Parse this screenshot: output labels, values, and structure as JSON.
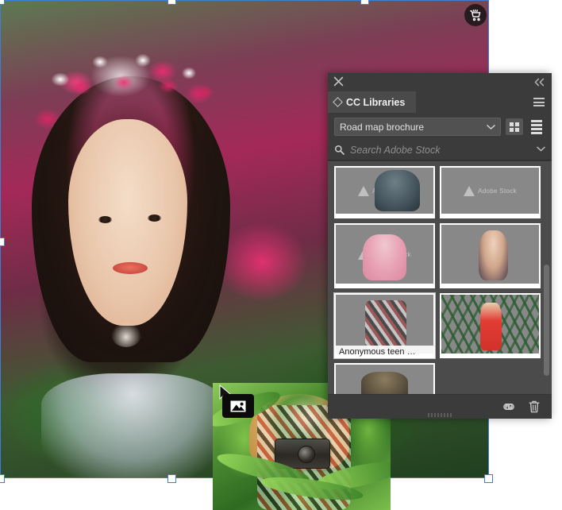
{
  "canvas": {
    "name": "artboard-selection",
    "cart_badge_icon": "shopping-cart-icon",
    "selection_color": "#3d7fd1",
    "photo_alt": "Woman wearing a flower crown among pink blossoms"
  },
  "drag_preview": {
    "name": "drag-preview-thumbnail",
    "badge_icon": "image-placed-icon",
    "cursor_icon": "arrow-cursor-icon",
    "photo_alt": "Teenage girl photographing through corn leaves"
  },
  "panel": {
    "close_icon": "close-icon",
    "collapse_icon": "double-chevron-left-icon",
    "menu_icon": "panel-menu-icon",
    "tab_label": "CC Libraries",
    "tab_icon": "diamond-icon",
    "library_select": {
      "value": "Road map brochure",
      "chevron_icon": "chevron-down-icon"
    },
    "view_grid": {
      "label": "grid-view",
      "icon": "grid-view-icon",
      "active": true
    },
    "view_list": {
      "label": "list-view",
      "icon": "list-view-icon",
      "active": false
    },
    "search": {
      "placeholder": "Search Adobe Stock",
      "value": "",
      "icon": "search-icon",
      "chevron_icon": "chevron-down-icon"
    },
    "watermark_text": "Adobe Stock",
    "thumbnails": [
      {
        "id": "t1",
        "caption": "",
        "watermark": true,
        "selected": false
      },
      {
        "id": "t2",
        "caption": "",
        "watermark": true,
        "selected": false
      },
      {
        "id": "t3",
        "caption": "",
        "watermark": true,
        "selected": false
      },
      {
        "id": "t4",
        "caption": "",
        "watermark": false,
        "selected": false
      },
      {
        "id": "t5",
        "caption": "Anonymous teen …",
        "watermark": false,
        "selected": true
      },
      {
        "id": "t6",
        "caption": "",
        "watermark": false,
        "selected": false
      },
      {
        "id": "t7",
        "caption": "",
        "watermark": false,
        "selected": false
      }
    ],
    "footer": {
      "sync_icon": "creative-cloud-icon",
      "delete_icon": "trash-icon"
    },
    "scrollbar": {
      "name": "vertical-scrollbar"
    }
  }
}
